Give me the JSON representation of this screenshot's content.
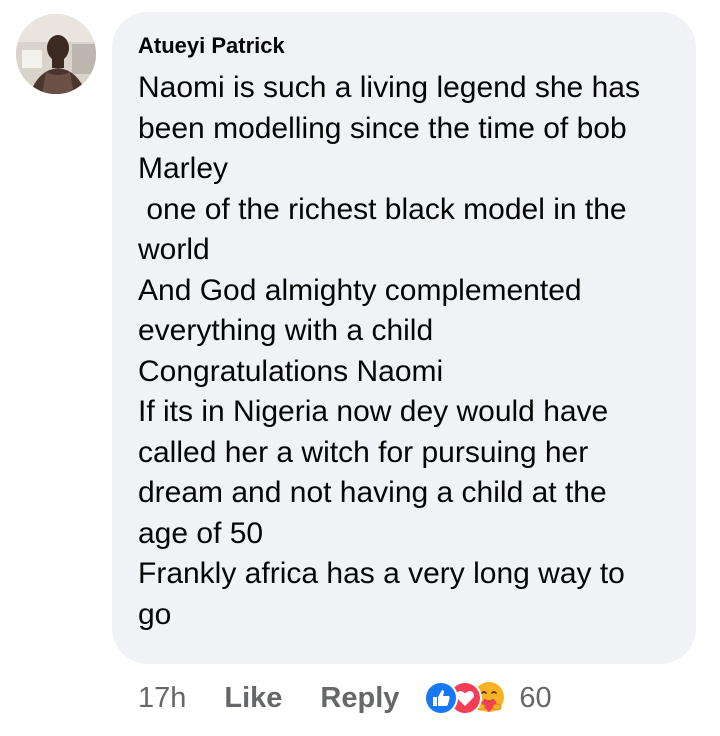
{
  "comment": {
    "author": "Atueyi Patrick",
    "lines": [
      "Naomi is such a living legend she has",
      "been modelling since the time of bob",
      "Marley",
      " one of the richest black model in the",
      "world",
      "And God almighty complemented",
      "everything with a child",
      "Congratulations Naomi",
      "If its in Nigeria now dey would have",
      "called her a witch for pursuing her",
      "dream and not having a child at the",
      "age of 50",
      "Frankly africa has a very long way to",
      "go"
    ]
  },
  "actions": {
    "timestamp": "17h",
    "like_label": "Like",
    "reply_label": "Reply"
  },
  "reactions": {
    "icons": [
      "like-reaction-icon",
      "love-reaction-icon",
      "care-reaction-icon"
    ],
    "count": "60",
    "colors": {
      "like": "#1877f2",
      "love": "#f33e58",
      "care": "#f7b125"
    }
  },
  "colors": {
    "bubble_bg": "#f0f2f5",
    "text": "#050505",
    "secondary_text": "#65676b"
  }
}
